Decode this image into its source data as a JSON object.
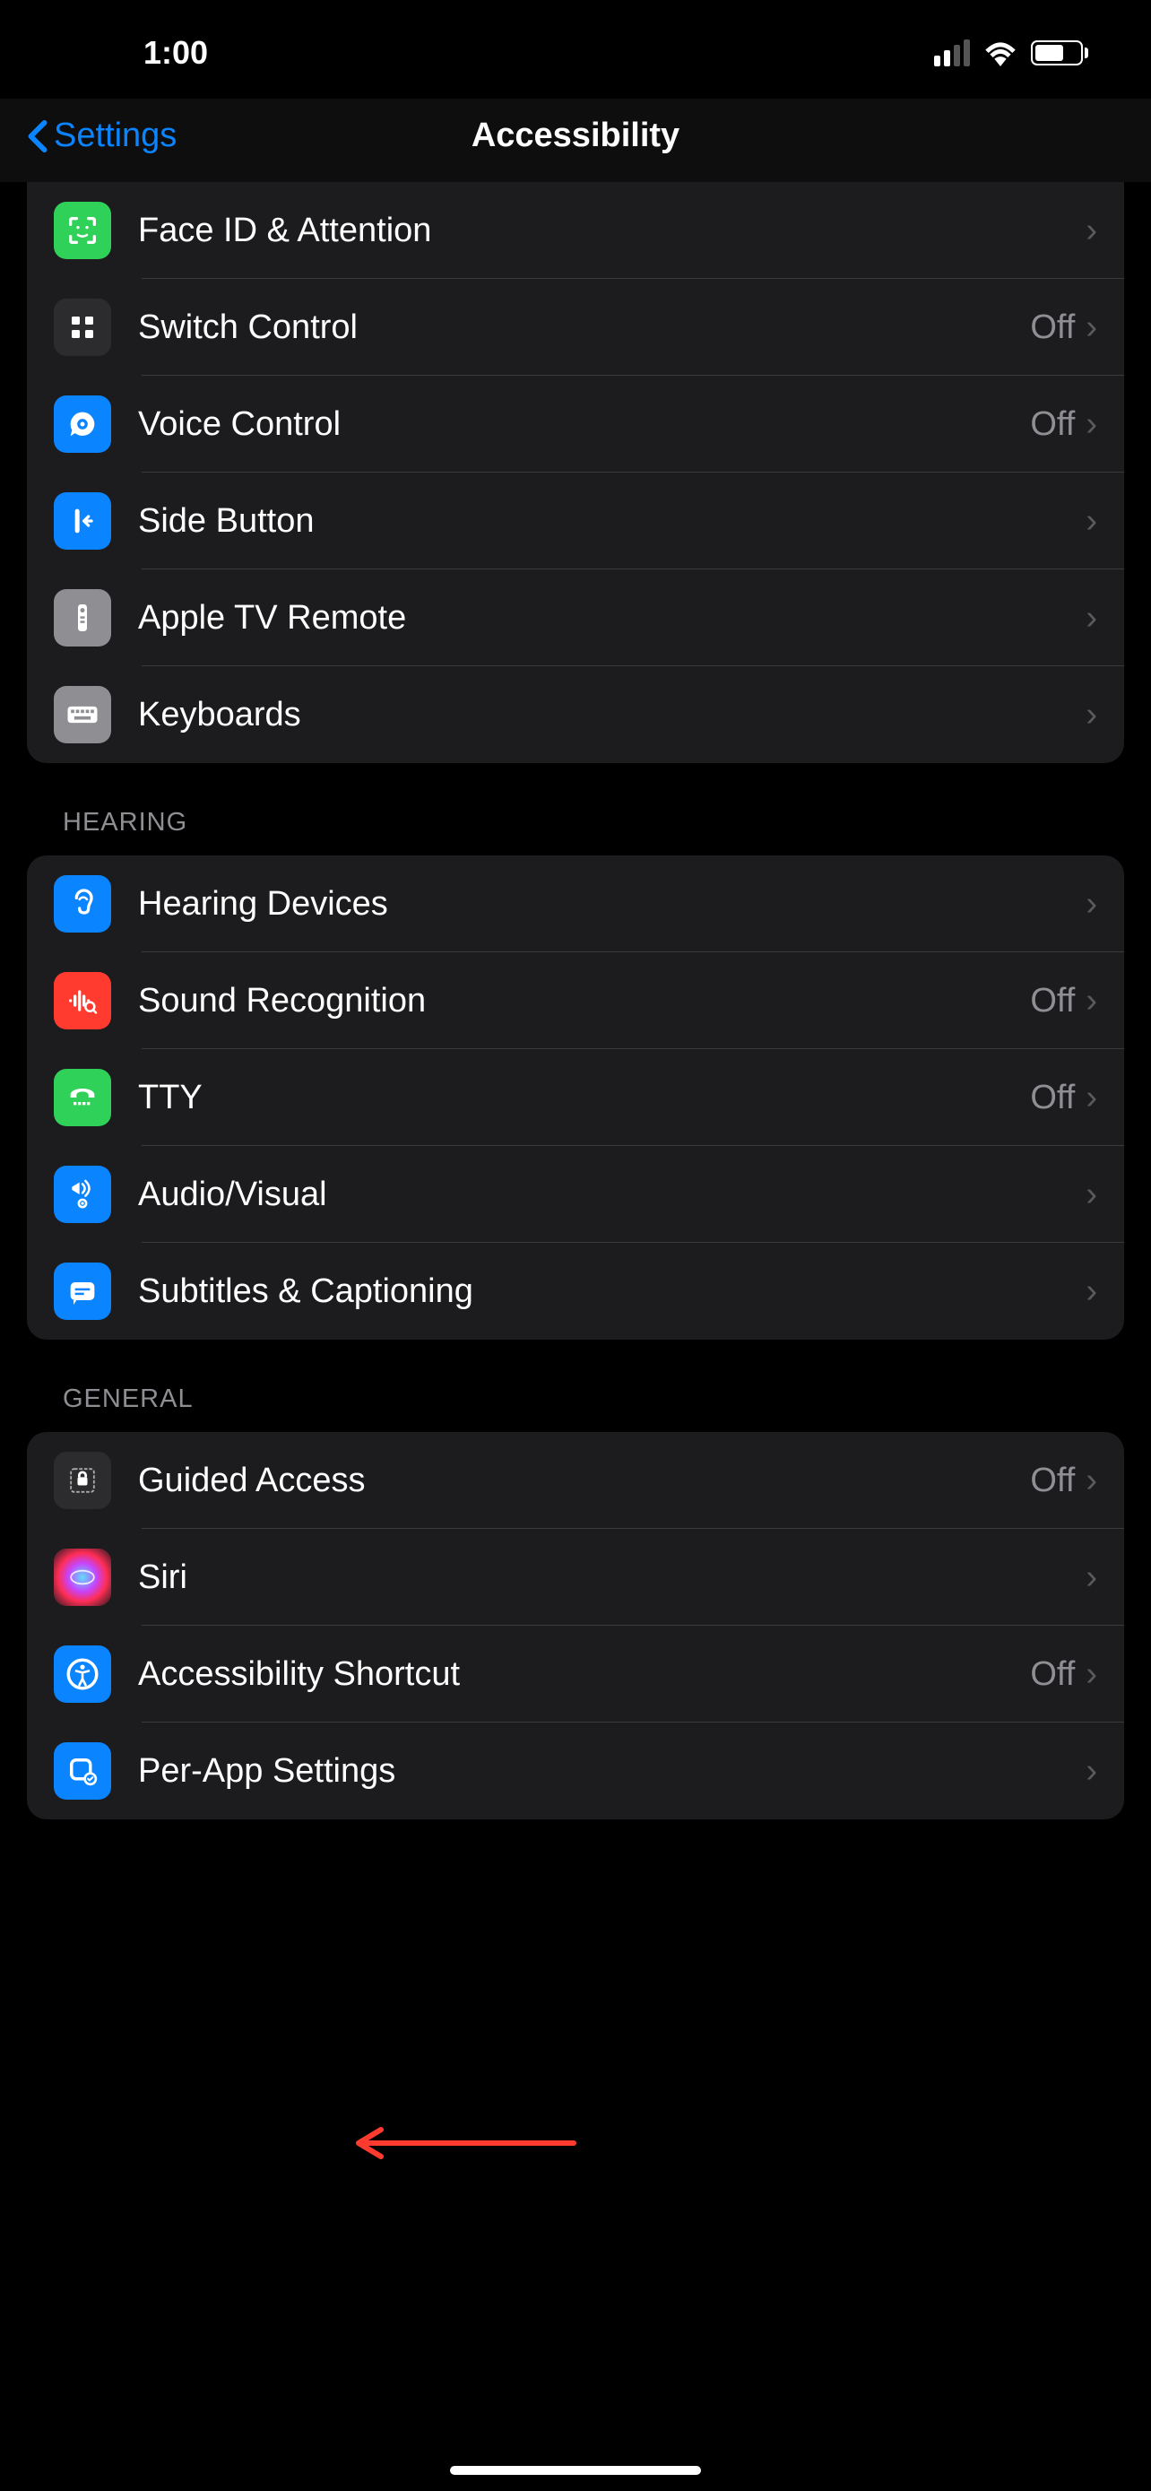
{
  "status": {
    "time": "1:00"
  },
  "nav": {
    "back": "Settings",
    "title": "Accessibility"
  },
  "sections": [
    {
      "header": null,
      "rows": [
        {
          "icon": "face-id",
          "iconBg": "#30d158",
          "label": "Face ID & Attention",
          "value": null
        },
        {
          "icon": "switch-control",
          "iconBg": "#2c2c2e",
          "label": "Switch Control",
          "value": "Off"
        },
        {
          "icon": "voice-control",
          "iconBg": "#0a84ff",
          "label": "Voice Control",
          "value": "Off"
        },
        {
          "icon": "side-button",
          "iconBg": "#0a84ff",
          "label": "Side Button",
          "value": null
        },
        {
          "icon": "tv-remote",
          "iconBg": "#8e8e93",
          "label": "Apple TV Remote",
          "value": null
        },
        {
          "icon": "keyboard",
          "iconBg": "#8e8e93",
          "label": "Keyboards",
          "value": null
        }
      ]
    },
    {
      "header": "HEARING",
      "rows": [
        {
          "icon": "ear",
          "iconBg": "#0a84ff",
          "label": "Hearing Devices",
          "value": null
        },
        {
          "icon": "sound-recognition",
          "iconBg": "#ff3b30",
          "label": "Sound Recognition",
          "value": "Off"
        },
        {
          "icon": "tty",
          "iconBg": "#30d158",
          "label": "TTY",
          "value": "Off"
        },
        {
          "icon": "audio-visual",
          "iconBg": "#0a84ff",
          "label": "Audio/Visual",
          "value": null
        },
        {
          "icon": "subtitles",
          "iconBg": "#0a84ff",
          "label": "Subtitles & Captioning",
          "value": null
        }
      ]
    },
    {
      "header": "GENERAL",
      "rows": [
        {
          "icon": "guided-access",
          "iconBg": "#2c2c2e",
          "label": "Guided Access",
          "value": "Off"
        },
        {
          "icon": "siri",
          "iconBg": "radial",
          "label": "Siri",
          "value": null
        },
        {
          "icon": "accessibility-shortcut",
          "iconBg": "#0a84ff",
          "label": "Accessibility Shortcut",
          "value": "Off"
        },
        {
          "icon": "per-app",
          "iconBg": "#0a84ff",
          "label": "Per-App Settings",
          "value": null
        }
      ]
    }
  ]
}
